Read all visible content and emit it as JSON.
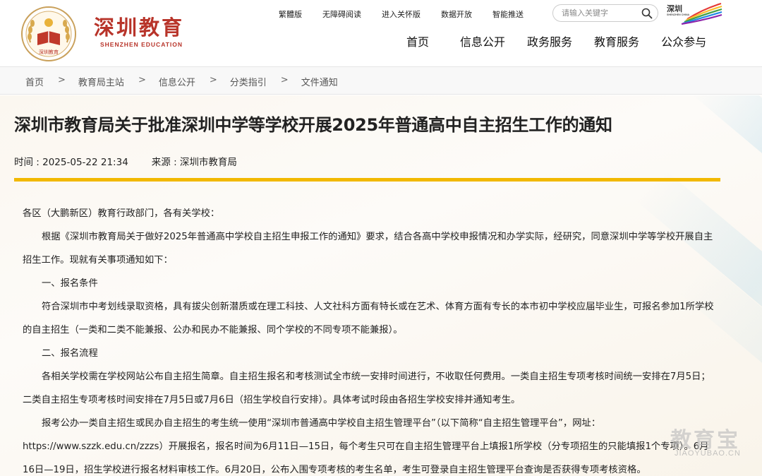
{
  "brand": {
    "name_cn": "深圳教育",
    "name_en": "SHENZHEN EDUCATION",
    "emblem_text": "深圳教育",
    "city_logo_text": "深圳",
    "city_logo_en": "SHENZHEN CHINA",
    "color": "#b8342a"
  },
  "top_links": [
    "繁體版",
    "无障碍阅读",
    "进入关怀版",
    "数据开放",
    "智能推送"
  ],
  "search": {
    "placeholder": "请输入关键字",
    "icon": "search-icon"
  },
  "main_nav": [
    "首页",
    "信息公开",
    "政务服务",
    "教育服务",
    "公众参与"
  ],
  "breadcrumb": [
    "首页",
    "教育局主站",
    "信息公开",
    "分类指引",
    "文件通知"
  ],
  "breadcrumb_sep": ">",
  "article": {
    "title": "深圳市教育局关于批准深圳中学等学校开展2025年普通高中自主招生工作的通知",
    "time": "时间 : 2025-05-22 21:34",
    "source": "来源 : 深圳市教育局",
    "accent_color": "#f2b800",
    "paragraphs": [
      "各区（大鹏新区）教育行政部门，各有关学校：",
      "根据《深圳市教育局关于做好2025年普通高中学校自主招生申报工作的通知》要求，结合各高中学校申报情况和办学实际，经研究，同意深圳中学等学校开展自主招生工作。现就有关事项通知如下：",
      "一、报名条件",
      "符合深圳市中考划线录取资格，具有拔尖创新潜质或在理工科技、人文社科方面有特长或在艺术、体育方面有专长的本市初中学校应届毕业生，可报名参加1所学校的自主招生（一类和二类不能兼报、公办和民办不能兼报、同个学校的不同专项不能兼报）。",
      "二、报名流程",
      "各相关学校需在学校网站公布自主招生简章。自主招生报名和考核测试全市统一安排时间进行，不收取任何费用。一类自主招生专项考核时间统一安排在7月5日；二类自主招生专项考核时间安排在7月5日或7月6日（招生学校自行安排）。具体考试时段由各招生学校安排并通知考生。",
      "报考公办一类自主招生或民办自主招生的考生统一使用“深圳市普通高中学校自主招生管理平台”（以下简称“自主招生管理平台”，网址：https://www.szzk.edu.cn/zzzs）开展报名，报名时间为6月11日—15日，每个考生只可在自主招生管理平台上填报1所学校（分专项招生的只能填报1个专项）。6月16日—19日，招生学校进行报名材料审核工作。6月20日，公布入围专项考核的考生名单，考生可登录自主招生管理平台查询是否获得专项考核资格。"
    ]
  },
  "watermark": {
    "cn": "教育宝",
    "en": "JIAOYUBAO.CN"
  }
}
